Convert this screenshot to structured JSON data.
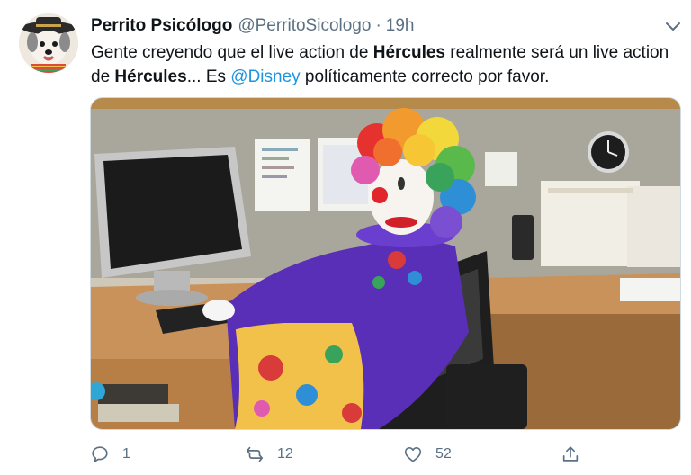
{
  "tweet": {
    "display_name": "Perrito Psicólogo",
    "handle": "@PerritoSicologo",
    "separator": "·",
    "time": "19h",
    "text": {
      "p1": "Gente creyendo que el live action de ",
      "b1": "Hércules",
      "p2": " realmente será un live action de ",
      "b2": "Hércules",
      "p3": "... Es ",
      "mention": "@Disney",
      "p4": " políticamente correcto por favor."
    },
    "avatar_icon": "dog-sombrero-avatar",
    "media_description_icon": "clown-at-computer-photo"
  },
  "actions": {
    "reply": {
      "icon": "reply-icon",
      "count": "1"
    },
    "retweet": {
      "icon": "retweet-icon",
      "count": "12"
    },
    "like": {
      "icon": "heart-icon",
      "count": "52"
    },
    "share": {
      "icon": "share-icon"
    }
  },
  "colors": {
    "link": "#1b95e0",
    "muted": "#5b7083",
    "text": "#0f1419",
    "clown_suit": "#5a2fb8"
  }
}
